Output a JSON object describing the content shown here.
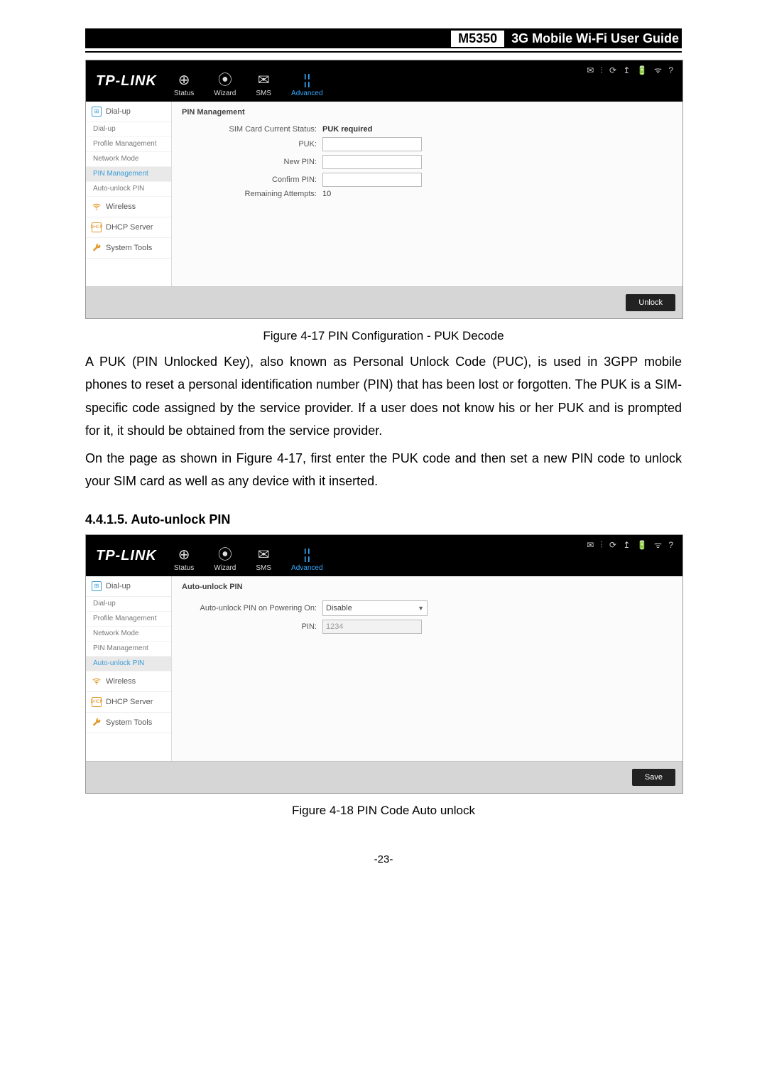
{
  "header": {
    "model": "M5350",
    "title": "3G Mobile Wi-Fi User Guide"
  },
  "brand": "TP-LINK",
  "nav": {
    "status": "Status",
    "wizard": "Wizard",
    "sms": "SMS",
    "advanced": "Advanced"
  },
  "status_icons": "✉ ⫶ ⟳ ↥ 🔋 ᯤ ?",
  "sidebar": {
    "dialup": "Dial-up",
    "items": {
      "dialup": "Dial-up",
      "profile": "Profile Management",
      "network": "Network Mode",
      "pin": "PIN Management",
      "auto": "Auto-unlock PIN"
    },
    "wireless": "Wireless",
    "dhcp": "DHCP Server",
    "tools": "System Tools"
  },
  "pin_mgmt": {
    "heading": "PIN Management",
    "sim_label": "SIM Card Current Status:",
    "sim_value": "PUK required",
    "puk_label": "PUK:",
    "newpin_label": "New PIN:",
    "confirm_label": "Confirm PIN:",
    "remaining_label": "Remaining Attempts:",
    "remaining_value": "10",
    "button": "Unlock"
  },
  "caption1": "Figure 4-17 PIN Configuration - PUK Decode",
  "para1": "A PUK (PIN Unlocked Key), also known as Personal Unlock Code (PUC), is used in 3GPP mobile phones to reset a personal identification number (PIN) that has been lost or forgotten. The PUK is a SIM-specific code assigned by the service provider. If a user does not know his or her PUK and is prompted for it, it should be obtained from the service provider.",
  "para2": "On the page as shown in Figure 4-17, first enter the PUK code and then set a new PIN code to unlock your SIM card as well as any device with it inserted.",
  "section": "4.4.1.5.  Auto-unlock PIN",
  "auto": {
    "heading": "Auto-unlock PIN",
    "power_label": "Auto-unlock PIN on Powering On:",
    "power_value": "Disable",
    "pin_label": "PIN:",
    "pin_value": "1234",
    "button": "Save"
  },
  "caption2": "Figure 4-18 PIN Code Auto unlock",
  "pagenum": "-23-"
}
